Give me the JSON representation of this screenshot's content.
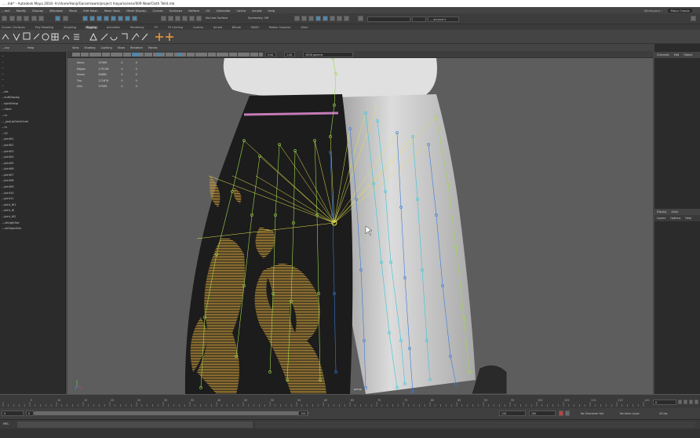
{
  "window": {
    "title": "... .mb* - Autodesk Maya 2018: H:/share/Hanji/Garam/work/project maya/scenes/009 New/Cloth Tell4.mb"
  },
  "menubar": {
    "items": [
      "...lect",
      "Modify",
      "Display",
      "Windows",
      "Mesh",
      "Edit Mesh",
      "Mesh Tools",
      "Mesh Display",
      "Curves",
      "Surfaces",
      "Deform",
      "UV",
      "Generate",
      "Cache",
      "Arnold",
      "Help"
    ],
    "workspace": "Workspace :",
    "workspace_value": "Maya Classic"
  },
  "statusline": {
    "no_live_surface": "No Live Surface",
    "symmetry": "Symmetry: Off",
    "login": "... account ▾"
  },
  "shelf_tabs": [
    "Curves / Surfaces",
    "Poly Modeling",
    "Sculpting",
    "Rigging",
    "Animation",
    "Rendering",
    "FX",
    "FX Caching",
    "Custom",
    "Arnold",
    "Bifrost",
    "MASH",
    "Motion Graphics",
    "XGen"
  ],
  "shelf_active": "Rigging",
  "outliner": {
    "header_left": "...lay",
    "header_right": "Help",
    "items": [
      "...",
      "...",
      "...",
      "...",
      "...",
      "...",
      "...efs",
      "...aultDisplay",
      "...lightSetup",
      "...utput",
      "...ro",
      "..._jawUpClothOcde",
      "...ro",
      "...02",
      "...joint01",
      "...joint02",
      "...joint03",
      "...joint04",
      "...joint05",
      "...joint06",
      "...joint07",
      "...joint08",
      "...joint09",
      "...joint10",
      "...joint11",
      "...joint_IK1",
      "...joint_IK",
      "...joint_IK2",
      "...ultLightSet",
      "...ultObjectSet"
    ]
  },
  "viewport": {
    "menu": [
      "View",
      "Shading",
      "Lighting",
      "Show",
      "Renderer",
      "Panels"
    ],
    "exposure": "0.00",
    "gamma": "1.00",
    "color_space": "sRGB gamma",
    "hud": [
      {
        "label": "Verts:",
        "a": "97999",
        "b": "0",
        "c": "0"
      },
      {
        "label": "Edges:",
        "a": "175136",
        "b": "0",
        "c": "0"
      },
      {
        "label": "Faces:",
        "a": "83882",
        "b": "0",
        "c": "0"
      },
      {
        "label": "Tris:",
        "a": "171679",
        "b": "0",
        "c": "0"
      },
      {
        "label": "UVs:",
        "a": "97999",
        "b": "0",
        "c": "0"
      }
    ],
    "camera_label": "persp"
  },
  "channel_box": {
    "tabs": [
      "Channels",
      "Edit",
      "Object"
    ]
  },
  "layer_editor": {
    "tabs": [
      "Display",
      "Anim"
    ],
    "subtabs": [
      "Layers",
      "Options",
      "Help"
    ]
  },
  "timeline": {
    "ticks": [
      "5",
      "10",
      "15",
      "20",
      "25",
      "30",
      "35",
      "40",
      "45",
      "50",
      "55",
      "60",
      "65",
      "70",
      "75",
      "80",
      "85",
      "90",
      "95",
      "100",
      "105",
      "110",
      "115",
      "120"
    ],
    "current_frame": "0"
  },
  "range": {
    "start": "0",
    "inner_start": "0",
    "inner_end": "120",
    "end": "120",
    "end_2": "200",
    "char_set": "No Character Set",
    "anim_layer": "No Anim Layer",
    "fps": "24 fps"
  },
  "cmdline": {
    "label": "MEL"
  },
  "colors": {
    "skirt": "#1c1c1c",
    "pattern": "#c79a3a",
    "white_cloth": "#d8d8d8",
    "joint_green": "#9fd84a",
    "joint_yellow": "#e4e24a",
    "joint_blue": "#3a7ad8",
    "joint_cyan": "#3ac4d8",
    "band": "#c77ab8"
  }
}
